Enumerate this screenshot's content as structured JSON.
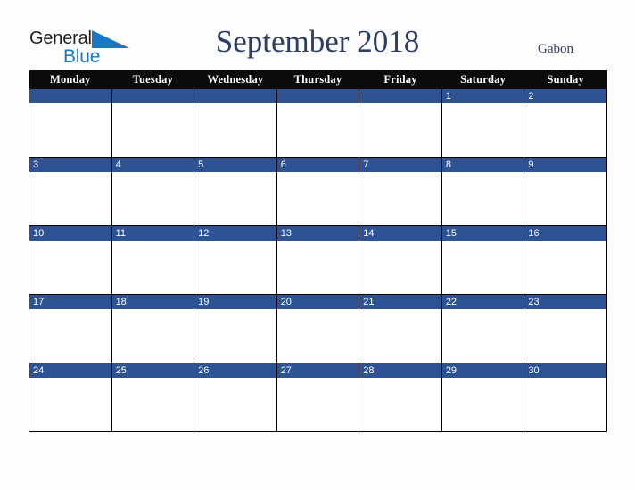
{
  "brand": {
    "name_part_1": "General",
    "name_part_2": "Blue",
    "triangle_icon": "blue-triangle-icon",
    "colors": {
      "general_text": "#231f20",
      "blue_text": "#1878c8",
      "triangle": "#1878c8"
    }
  },
  "header": {
    "title": "September 2018",
    "country": "Gabon"
  },
  "colors": {
    "page_background": "#fdfdfd",
    "header_row_background": "#0b0b0b",
    "header_row_text": "#ffffff",
    "date_bar_background": "#2d5394",
    "date_bar_text": "#ffffff",
    "cell_background": "#ffffff",
    "grid_border": "#000000",
    "title_text": "#2c3e66"
  },
  "calendar": {
    "month": "September",
    "year": "2018",
    "first_day_of_week": "Monday",
    "weekday_headers": [
      "Monday",
      "Tuesday",
      "Wednesday",
      "Thursday",
      "Friday",
      "Saturday",
      "Sunday"
    ],
    "weeks": [
      {
        "days": [
          {
            "date": "",
            "empty": true
          },
          {
            "date": "",
            "empty": true
          },
          {
            "date": "",
            "empty": true
          },
          {
            "date": "",
            "empty": true
          },
          {
            "date": "",
            "empty": true
          },
          {
            "date": "1",
            "empty": false
          },
          {
            "date": "2",
            "empty": false
          }
        ]
      },
      {
        "days": [
          {
            "date": "3",
            "empty": false
          },
          {
            "date": "4",
            "empty": false
          },
          {
            "date": "5",
            "empty": false
          },
          {
            "date": "6",
            "empty": false
          },
          {
            "date": "7",
            "empty": false
          },
          {
            "date": "8",
            "empty": false
          },
          {
            "date": "9",
            "empty": false
          }
        ]
      },
      {
        "days": [
          {
            "date": "10",
            "empty": false
          },
          {
            "date": "11",
            "empty": false
          },
          {
            "date": "12",
            "empty": false
          },
          {
            "date": "13",
            "empty": false
          },
          {
            "date": "14",
            "empty": false
          },
          {
            "date": "15",
            "empty": false
          },
          {
            "date": "16",
            "empty": false
          }
        ]
      },
      {
        "days": [
          {
            "date": "17",
            "empty": false
          },
          {
            "date": "18",
            "empty": false
          },
          {
            "date": "19",
            "empty": false
          },
          {
            "date": "20",
            "empty": false
          },
          {
            "date": "21",
            "empty": false
          },
          {
            "date": "22",
            "empty": false
          },
          {
            "date": "23",
            "empty": false
          }
        ]
      },
      {
        "days": [
          {
            "date": "24",
            "empty": false
          },
          {
            "date": "25",
            "empty": false
          },
          {
            "date": "26",
            "empty": false
          },
          {
            "date": "27",
            "empty": false
          },
          {
            "date": "28",
            "empty": false
          },
          {
            "date": "29",
            "empty": false
          },
          {
            "date": "30",
            "empty": false
          }
        ]
      }
    ]
  }
}
